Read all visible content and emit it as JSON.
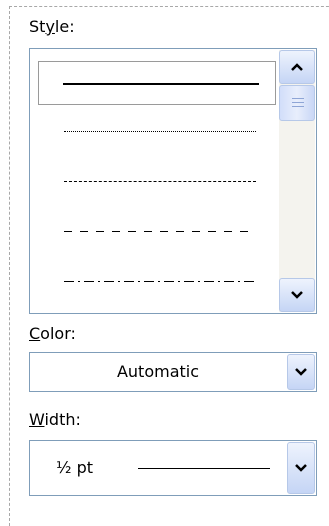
{
  "style_section": {
    "label": "Style:",
    "label_access_key": "y",
    "options": [
      {
        "name": "solid",
        "selected": true
      },
      {
        "name": "dotted",
        "selected": false
      },
      {
        "name": "dashed-short",
        "selected": false
      },
      {
        "name": "dashed-long",
        "selected": false
      },
      {
        "name": "dash-dot",
        "selected": false
      }
    ]
  },
  "color_section": {
    "label": "Color:",
    "label_access_key": "C",
    "value": "Automatic"
  },
  "width_section": {
    "label": "Width:",
    "label_access_key": "W",
    "value": "½ pt"
  },
  "icons": {
    "scroll_up": "chevron-up-icon",
    "scroll_down": "chevron-down-icon",
    "dropdown": "chevron-down-icon"
  },
  "colors": {
    "border": "#7f9db9",
    "button_border": "#b6c8e8",
    "selection_border": "#9a9a9a"
  }
}
